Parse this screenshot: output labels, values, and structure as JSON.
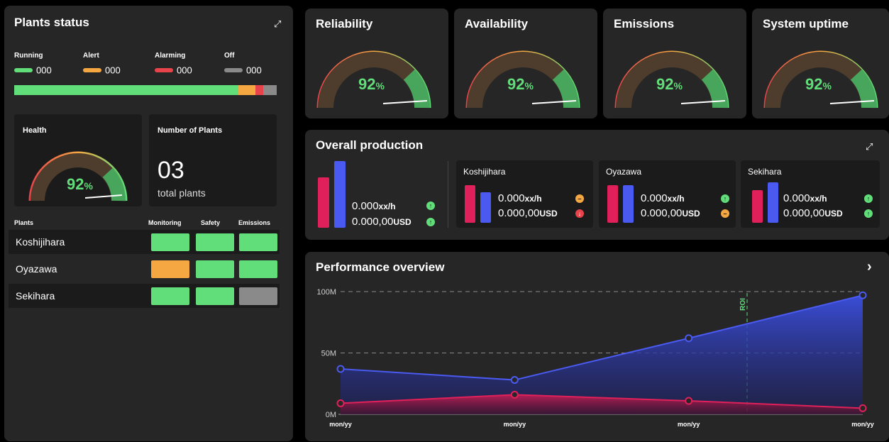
{
  "plants_status": {
    "title": "Plants status",
    "legend": [
      {
        "label": "Running",
        "value": "000",
        "color": "#61de7a"
      },
      {
        "label": "Alert",
        "value": "000",
        "color": "#f5a742"
      },
      {
        "label": "Alarming",
        "value": "000",
        "color": "#e8434b"
      },
      {
        "label": "Off",
        "value": "000",
        "color": "#8a8a8a"
      }
    ],
    "health": {
      "label": "Health",
      "value": "92",
      "unit": "%"
    },
    "plants_count": {
      "label": "Number of Plants",
      "value": "03",
      "caption": "total plants"
    },
    "table": {
      "headers": [
        "Plants",
        "Monitoring",
        "Safety",
        "Emissions"
      ],
      "rows": [
        {
          "name": "Koshijihara",
          "states": [
            "#61de7a",
            "#61de7a",
            "#61de7a"
          ]
        },
        {
          "name": "Oyazawa",
          "states": [
            "#f5a742",
            "#61de7a",
            "#61de7a"
          ]
        },
        {
          "name": "Sekihara",
          "states": [
            "#61de7a",
            "#61de7a",
            "#8a8a8a"
          ]
        }
      ]
    }
  },
  "kpis": [
    {
      "title": "Reliability",
      "value": "92",
      "unit": "%"
    },
    {
      "title": "Availability",
      "value": "92",
      "unit": "%"
    },
    {
      "title": "Emissions",
      "value": "92",
      "unit": "%"
    },
    {
      "title": "System uptime",
      "value": "92",
      "unit": "%"
    }
  ],
  "production": {
    "title": "Overall production",
    "overall": {
      "rate": "0.000",
      "rate_unit": "xx/h",
      "money": "0.000,00",
      "money_unit": "USD"
    },
    "plants": [
      {
        "name": "Koshijihara",
        "rate": "0.000",
        "rate_unit": "xx/h",
        "money": "0.000,00",
        "money_unit": "USD"
      },
      {
        "name": "Oyazawa",
        "rate": "0.000",
        "rate_unit": "xx/h",
        "money": "0.000,00",
        "money_unit": "USD"
      },
      {
        "name": "Sekihara",
        "rate": "0.000",
        "rate_unit": "xx/h",
        "money": "0.000,00",
        "money_unit": "USD"
      }
    ]
  },
  "performance": {
    "title": "Performance overview",
    "roi_label": "ROI",
    "chart_data": {
      "type": "area",
      "x": [
        "mon/yy",
        "mon/yy",
        "mon/yy",
        "mon/yy"
      ],
      "yticks": [
        "0M",
        "50M",
        "100M"
      ],
      "ylim": [
        0,
        100
      ],
      "series": [
        {
          "color": "#4a5af0",
          "values": [
            37,
            28,
            62,
            97
          ]
        },
        {
          "color": "#e0205a",
          "values": [
            9,
            16,
            11,
            5
          ]
        }
      ],
      "grid": true
    }
  },
  "colors": {
    "green": "#61de7a",
    "orange": "#f5a742",
    "red": "#e8434b",
    "blue": "#4a5af0",
    "pink": "#e0205a"
  }
}
